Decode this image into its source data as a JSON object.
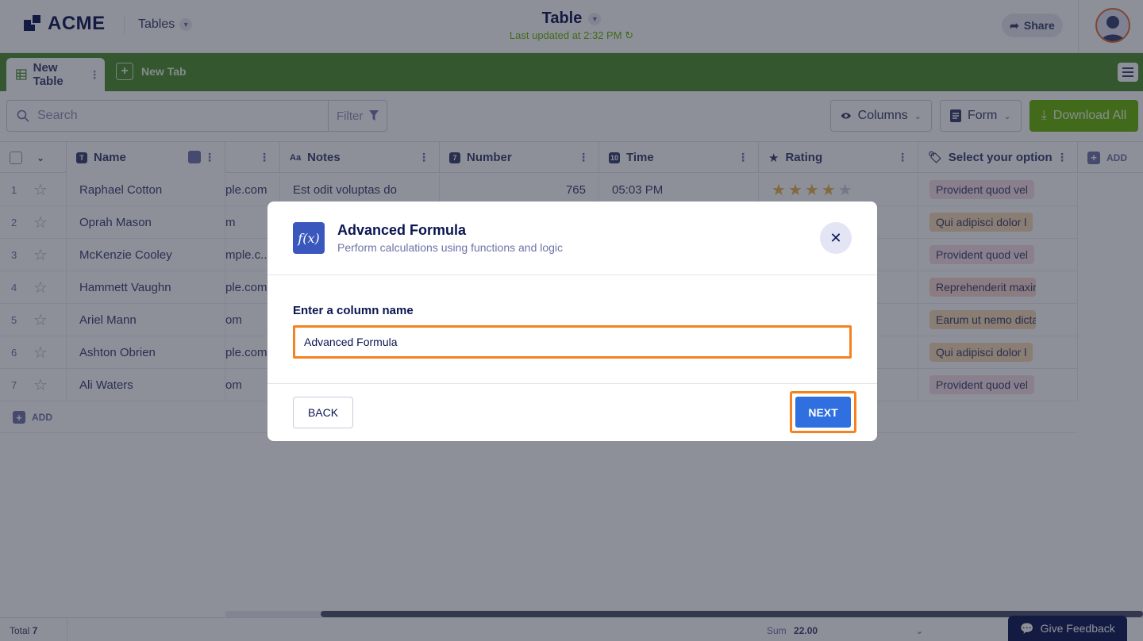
{
  "header": {
    "logo_text": "ACME",
    "nav_label": "Tables",
    "title": "Table",
    "last_updated": "Last updated at 2:32 PM",
    "share_label": "Share"
  },
  "tabs": {
    "active_tab": "New Table",
    "new_tab": "New Tab"
  },
  "toolbar": {
    "search_placeholder": "Search",
    "filter_label": "Filter",
    "columns_label": "Columns",
    "form_label": "Form",
    "download_label": "Download All"
  },
  "table": {
    "columns": {
      "name": "Name",
      "notes": "Notes",
      "number": "Number",
      "time": "Time",
      "rating": "Rating",
      "select": "Select your option",
      "add": "ADD"
    },
    "rows": [
      {
        "num": "1",
        "name": "Raphael Cotton",
        "email": "ple.com",
        "notes": "Est odit voluptas do",
        "number": "765",
        "time": "05:03 PM",
        "rating": 4,
        "option": "Provident quod vel"
      },
      {
        "num": "2",
        "name": "Oprah Mason",
        "email": "m",
        "notes": "",
        "number": "",
        "time": "",
        "rating": 0,
        "option": "Qui adipisci dolor l"
      },
      {
        "num": "3",
        "name": "McKenzie Cooley",
        "email": "mple.c...",
        "notes": "",
        "number": "",
        "time": "",
        "rating": 0,
        "option": "Provident quod vel"
      },
      {
        "num": "4",
        "name": "Hammett Vaughn",
        "email": "ple.com",
        "notes": "",
        "number": "",
        "time": "",
        "rating": 0,
        "option": "Reprehenderit maxime"
      },
      {
        "num": "5",
        "name": "Ariel Mann",
        "email": "om",
        "notes": "",
        "number": "",
        "time": "",
        "rating": 0,
        "option": "Earum ut nemo dicta"
      },
      {
        "num": "6",
        "name": "Ashton Obrien",
        "email": "ple.com",
        "notes": "",
        "number": "",
        "time": "",
        "rating": 0,
        "option": "Qui adipisci dolor l"
      },
      {
        "num": "7",
        "name": "Ali Waters",
        "email": "om",
        "notes": "",
        "number": "",
        "time": "",
        "rating": 0,
        "option": "Provident quod vel"
      }
    ],
    "add_row_label": "ADD"
  },
  "footer": {
    "total_label": "Total",
    "total_value": "7",
    "sum_label": "Sum",
    "sum_value": "22.00",
    "feedback_label": "Give Feedback"
  },
  "modal": {
    "title": "Advanced Formula",
    "subtitle": "Perform calculations using functions and logic",
    "icon_text": "f(x)",
    "field_label": "Enter a column name",
    "field_value": "Advanced Formula",
    "back_label": "BACK",
    "next_label": "NEXT"
  },
  "colors": {
    "brand_green": "#4a8c2a",
    "download_green": "#64b200",
    "highlight_orange": "#f58220",
    "primary_blue": "#2f6fe0",
    "navy": "#0a1551",
    "tag_colors": [
      "#f7dfe6",
      "#f5d8b4",
      "#f7dfe6",
      "#f7d6cf",
      "#f5d8b4",
      "#f5d8b4",
      "#f7dfe6"
    ]
  }
}
